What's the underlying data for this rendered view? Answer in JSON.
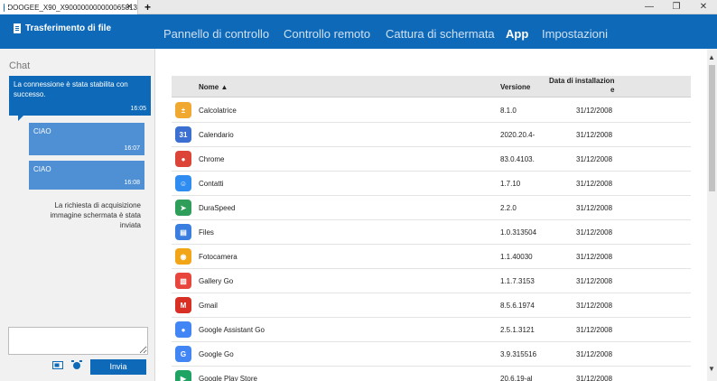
{
  "window": {
    "tab_title": "DOOGEE_X90_X900000000000065813",
    "tab_close": "✕",
    "tab_add": "+",
    "minimize": "—",
    "restore": "❐",
    "close": "✕"
  },
  "nav": {
    "brand": "Trasferimento di file",
    "items": [
      {
        "label": "Pannello di controllo",
        "active": false
      },
      {
        "label": "Controllo remoto",
        "active": false
      },
      {
        "label": "Cattura di schermata",
        "active": false
      },
      {
        "label": "App",
        "active": true
      },
      {
        "label": "Impostazioni",
        "active": false
      }
    ]
  },
  "chat": {
    "title": "Chat",
    "messages": [
      {
        "text": "La connessione è stata stabilita con successo.",
        "time": "16:05"
      },
      {
        "text": "CIAO",
        "time": "16:07"
      },
      {
        "text": "CIAO",
        "time": "16:08"
      }
    ],
    "system_message": "La richiesta di acquisizione immagine schermata è stata inviata",
    "input_value": "",
    "send_label": "Invia"
  },
  "table": {
    "headers": {
      "name": "Nome ▲",
      "version": "Versione",
      "install_date_line1": "Data di installazion",
      "install_date_line2": "e"
    },
    "rows": [
      {
        "name": "Calcolatrice",
        "version": "8.1.0",
        "date": "31/12/2008",
        "icon": "calculator-icon",
        "color": "#f0a830"
      },
      {
        "name": "Calendario",
        "version": "2020.20.4-",
        "date": "31/12/2008",
        "icon": "calendar-icon",
        "color": "#3b6fd1"
      },
      {
        "name": "Chrome",
        "version": "83.0.4103.",
        "date": "31/12/2008",
        "icon": "chrome-icon",
        "color": "#db4437"
      },
      {
        "name": "Contatti",
        "version": "1.7.10",
        "date": "31/12/2008",
        "icon": "contacts-icon",
        "color": "#2f8cf0"
      },
      {
        "name": "DuraSpeed",
        "version": "2.2.0",
        "date": "31/12/2008",
        "icon": "duraspeed-icon",
        "color": "#2e9e5a"
      },
      {
        "name": "Files",
        "version": "1.0.313504",
        "date": "31/12/2008",
        "icon": "files-icon",
        "color": "#3a7fe0"
      },
      {
        "name": "Fotocamera",
        "version": "1.1.40030",
        "date": "31/12/2008",
        "icon": "camera-icon",
        "color": "#f2a516"
      },
      {
        "name": "Gallery Go",
        "version": "1.1.7.3153",
        "date": "31/12/2008",
        "icon": "gallery-go-icon",
        "color": "#e8453c"
      },
      {
        "name": "Gmail",
        "version": "8.5.6.1974",
        "date": "31/12/2008",
        "icon": "gmail-icon",
        "color": "#d93025"
      },
      {
        "name": "Google Assistant Go",
        "version": "2.5.1.3121",
        "date": "31/12/2008",
        "icon": "assistant-go-icon",
        "color": "#4285f4"
      },
      {
        "name": "Google Go",
        "version": "3.9.315516",
        "date": "31/12/2008",
        "icon": "google-go-icon",
        "color": "#4285f4"
      },
      {
        "name": "Google Play Store",
        "version": "20.6.19-al",
        "date": "31/12/2008",
        "icon": "play-store-icon",
        "color": "#1ea362"
      }
    ]
  },
  "colors": {
    "accent": "#0e6ab8",
    "bubble_light": "#4f90d4"
  }
}
